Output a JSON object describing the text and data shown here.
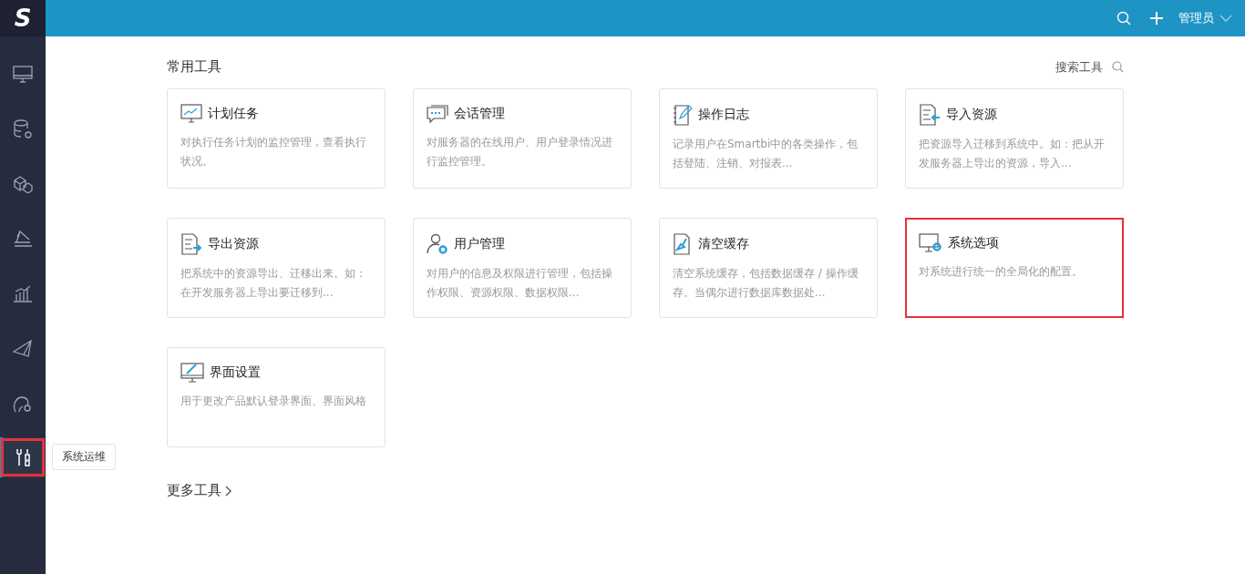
{
  "logo": {
    "text": "S"
  },
  "sidebar": {
    "items": [
      {
        "kind": "monitor",
        "selected": false,
        "outlined": false
      },
      {
        "kind": "database",
        "selected": false,
        "outlined": false
      },
      {
        "kind": "cubes",
        "selected": false,
        "outlined": false
      },
      {
        "kind": "ramp",
        "selected": false,
        "outlined": false
      },
      {
        "kind": "chart",
        "selected": false,
        "outlined": false
      },
      {
        "kind": "plane",
        "selected": false,
        "outlined": false
      },
      {
        "kind": "head",
        "selected": false,
        "outlined": false
      },
      {
        "kind": "tools",
        "selected": true,
        "outlined": true
      }
    ],
    "tooltip": "系统运维"
  },
  "topbar": {
    "user": "管理员"
  },
  "section": {
    "title": "常用工具",
    "search_label": "搜索工具"
  },
  "cards": [
    {
      "kind": "schedule",
      "title": "计划任务",
      "description": "对执行任务计划的监控管理，查看执行状况。",
      "highlighted": false
    },
    {
      "kind": "session",
      "title": "会话管理",
      "description": "对服务器的在线用户、用户登录情况进行监控管理。",
      "highlighted": false
    },
    {
      "kind": "log",
      "title": "操作日志",
      "description": "记录用户在Smartbi中的各类操作，包括登陆、注销、对报表...",
      "highlighted": false
    },
    {
      "kind": "import",
      "title": "导入资源",
      "description": "把资源导入迁移到系统中。如：把从开发服务器上导出的资源，导入...",
      "highlighted": false
    },
    {
      "kind": "export",
      "title": "导出资源",
      "description": "把系统中的资源导出、迁移出来。如：在开发服务器上导出要迁移到...",
      "highlighted": false
    },
    {
      "kind": "users",
      "title": "用户管理",
      "description": "对用户的信息及权限进行管理，包括操作权限、资源权限、数据权限...",
      "highlighted": false
    },
    {
      "kind": "cache",
      "title": "清空缓存",
      "description": "清空系统缓存，包括数据缓存 / 操作缓存。当偶尔进行数据库数据处...",
      "highlighted": false
    },
    {
      "kind": "options",
      "title": "系统选项",
      "description": "对系统进行统一的全局化的配置。",
      "highlighted": true
    },
    {
      "kind": "appearance",
      "title": "界面设置",
      "description": "用于更改产品默认登录界面、界面风格",
      "highlighted": false
    }
  ],
  "more_link": "更多工具"
}
